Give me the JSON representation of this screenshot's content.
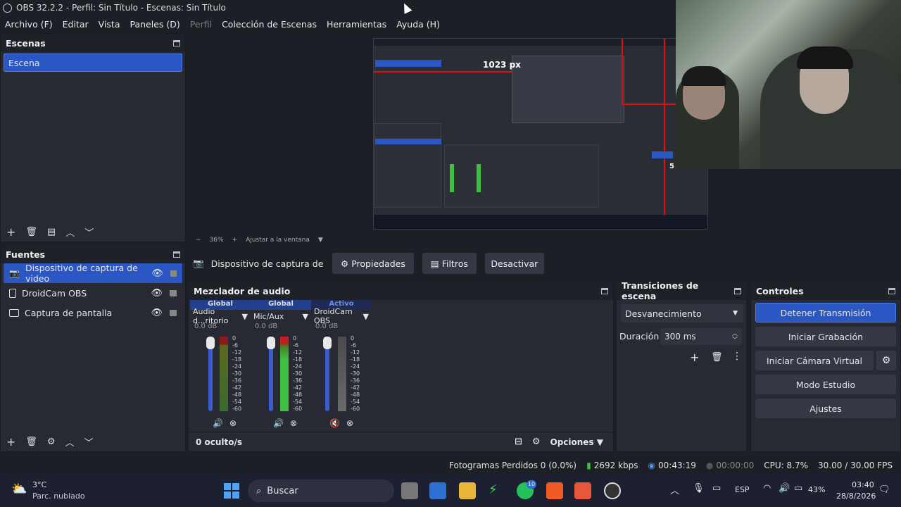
{
  "window": {
    "title": "OBS 32.2.2 - Perfil: Sin Título - Escenas: Sin Título"
  },
  "menu": [
    "Archivo (F)",
    "Editar",
    "Vista",
    "Paneles (D)",
    "Perfil",
    "Colección de Escenas",
    "Herramientas",
    "Ayuda (H)"
  ],
  "scenes": {
    "title": "Escenas",
    "items": [
      "Escena"
    ]
  },
  "sources": {
    "title": "Fuentes",
    "items": [
      "Dispositivo de captura de video",
      "DroidCam OBS",
      "Captura de pantalla"
    ]
  },
  "preview": {
    "zoom": "36%",
    "fit_label": "Ajustar a la ventana",
    "measure_label": "1023 px",
    "measure_label2": "5"
  },
  "context": {
    "source": "Dispositivo de captura de v",
    "properties": "Propiedades",
    "filters": "Filtros",
    "deactivate": "Desactivar"
  },
  "mixer": {
    "title": "Mezclador de audio",
    "channels": [
      {
        "header": "Global",
        "name": "Audio d...ritorio",
        "db": "0.0 dB",
        "muted": false
      },
      {
        "header": "Global",
        "name": "Mic/Aux",
        "db": "0.0 dB",
        "muted": false
      },
      {
        "header": "Activo",
        "name": "DroidCam OBS",
        "db": "0.0 dB",
        "muted": true
      }
    ],
    "scale": [
      "0",
      "-6",
      "-12",
      "-18",
      "-24",
      "-30",
      "-36",
      "-42",
      "-48",
      "-54",
      "-60"
    ],
    "hidden": "0 oculto/s",
    "options": "Opciones"
  },
  "transitions": {
    "title": "Transiciones de escena",
    "selected": "Desvanecimiento",
    "duration_label": "Duración",
    "duration_value": "300 ms"
  },
  "controls": {
    "title": "Controles",
    "buttons": [
      "Detener Transmisión",
      "Iniciar Grabación",
      "Iniciar Cámara Virtual",
      "Modo Estudio",
      "Ajustes"
    ]
  },
  "status": {
    "dropped": "Fotogramas Perdidos 0 (0.0%)",
    "bitrate": "2692 kbps",
    "stream_time": "00:43:19",
    "rec_time": "00:00:00",
    "cpu": "CPU: 8.7%",
    "fps": "30.00 / 30.00 FPS"
  },
  "taskbar": {
    "temp": "3°C",
    "weather": "Parc. nublado",
    "search": "Buscar",
    "lang": "ESP",
    "battery": "43%",
    "time": "03:40",
    "date": "28/8/2026",
    "badge": "10"
  },
  "colors": {
    "accent": "#2b57c4",
    "panel": "#272a33",
    "background": "#1d1f26",
    "meter_green": "#3fbf3f",
    "meter_red": "#c02020"
  }
}
